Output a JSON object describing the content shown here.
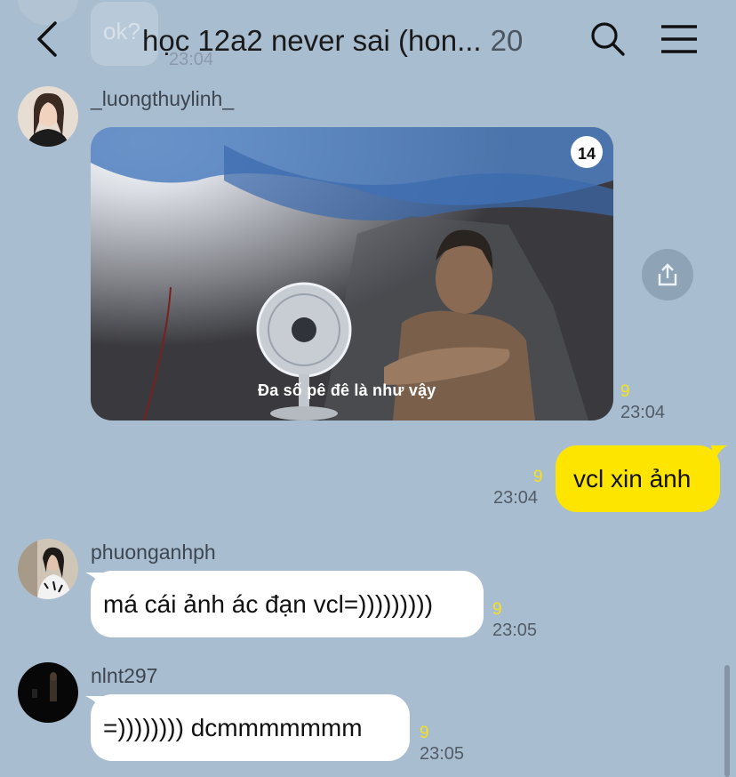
{
  "header": {
    "title": "học 12a2 never sai (hon...",
    "member_count": "20"
  },
  "previous_message": {
    "text": "ok?",
    "time": "23:04"
  },
  "messages": [
    {
      "sender": "_luongthuylinh_",
      "type": "image",
      "image_caption": "Đa số pê đê là như vậy",
      "image_badge": "14",
      "unread": "9",
      "time": "23:04"
    },
    {
      "sender": "me",
      "text": "vcl xin ảnh",
      "unread": "9",
      "time": "23:04"
    },
    {
      "sender": "phuonganhph",
      "text": "má cái ảnh ác đạn vcl=)))))))))",
      "unread": "9",
      "time": "23:05"
    },
    {
      "sender": "nlnt297",
      "text": "=)))))))) dcmmmmmmm",
      "unread": "9",
      "time": "23:05"
    }
  ],
  "colors": {
    "background": "#a9bdd1",
    "my_bubble": "#fee500",
    "other_bubble": "#ffffff",
    "unread": "#f7e21a"
  }
}
